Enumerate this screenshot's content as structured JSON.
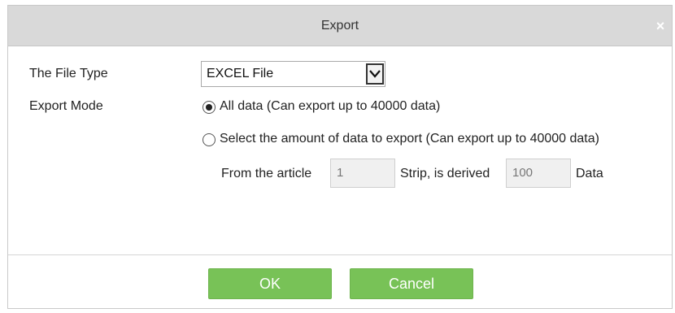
{
  "dialog": {
    "title": "Export",
    "close_glyph": "×"
  },
  "form": {
    "file_type_label": "The File Type",
    "file_type_value": "EXCEL File",
    "export_mode_label": "Export Mode",
    "option_all": "All data (Can export up to 40000 data)",
    "option_all_selected": true,
    "option_select": "Select the amount of data to export (Can export up to 40000 data)",
    "option_select_selected": false,
    "from_label": "From the article",
    "from_value": "1",
    "strip_label": "Strip, is derived",
    "count_value": "100",
    "data_label": "Data"
  },
  "buttons": {
    "ok": "OK",
    "cancel": "Cancel"
  },
  "colors": {
    "button_green": "#78c257",
    "titlebar": "#d9d9d9"
  }
}
